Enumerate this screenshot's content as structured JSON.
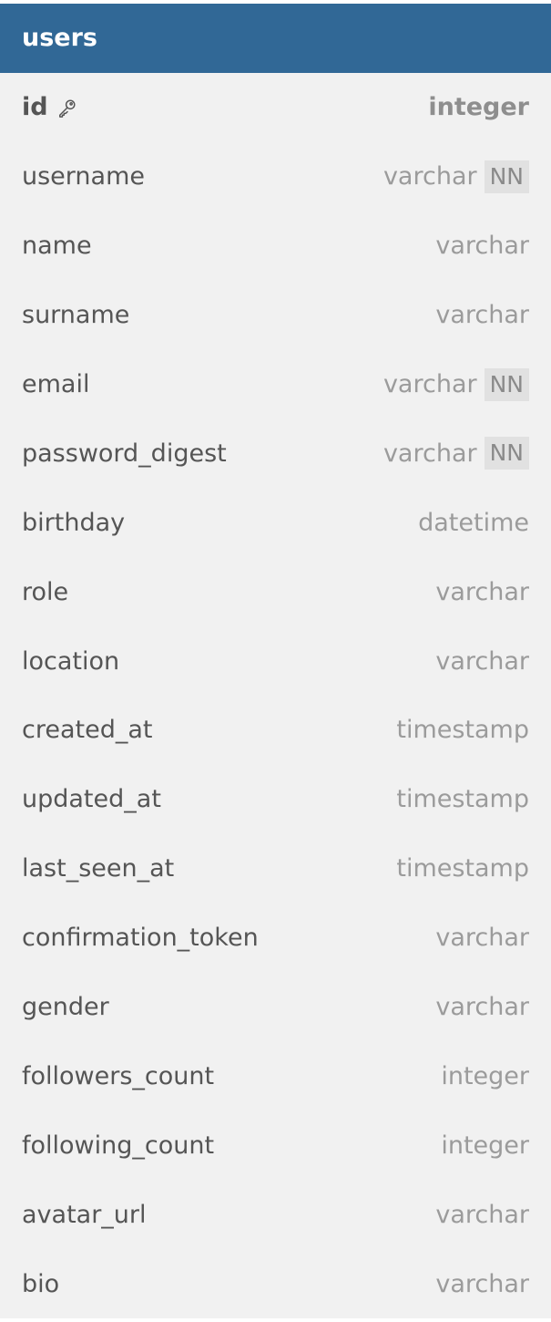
{
  "table": {
    "title": "users",
    "header_color": "#316896",
    "columns": [
      {
        "name": "id",
        "type": "integer",
        "primary_key": true,
        "badge": ""
      },
      {
        "name": "username",
        "type": "varchar",
        "primary_key": false,
        "badge": "NN"
      },
      {
        "name": "name",
        "type": "varchar",
        "primary_key": false,
        "badge": ""
      },
      {
        "name": "surname",
        "type": "varchar",
        "primary_key": false,
        "badge": ""
      },
      {
        "name": "email",
        "type": "varchar",
        "primary_key": false,
        "badge": "NN"
      },
      {
        "name": "password_digest",
        "type": "varchar",
        "primary_key": false,
        "badge": "NN"
      },
      {
        "name": "birthday",
        "type": "datetime",
        "primary_key": false,
        "badge": ""
      },
      {
        "name": "role",
        "type": "varchar",
        "primary_key": false,
        "badge": ""
      },
      {
        "name": "location",
        "type": "varchar",
        "primary_key": false,
        "badge": ""
      },
      {
        "name": "created_at",
        "type": "timestamp",
        "primary_key": false,
        "badge": ""
      },
      {
        "name": "updated_at",
        "type": "timestamp",
        "primary_key": false,
        "badge": ""
      },
      {
        "name": "last_seen_at",
        "type": "timestamp",
        "primary_key": false,
        "badge": ""
      },
      {
        "name": "confirmation_token",
        "type": "varchar",
        "primary_key": false,
        "badge": ""
      },
      {
        "name": "gender",
        "type": "varchar",
        "primary_key": false,
        "badge": ""
      },
      {
        "name": "followers_count",
        "type": "integer",
        "primary_key": false,
        "badge": ""
      },
      {
        "name": "following_count",
        "type": "integer",
        "primary_key": false,
        "badge": ""
      },
      {
        "name": "avatar_url",
        "type": "varchar",
        "primary_key": false,
        "badge": ""
      },
      {
        "name": "bio",
        "type": "varchar",
        "primary_key": false,
        "badge": ""
      }
    ]
  },
  "icons": {
    "primary_key": "key-icon"
  }
}
